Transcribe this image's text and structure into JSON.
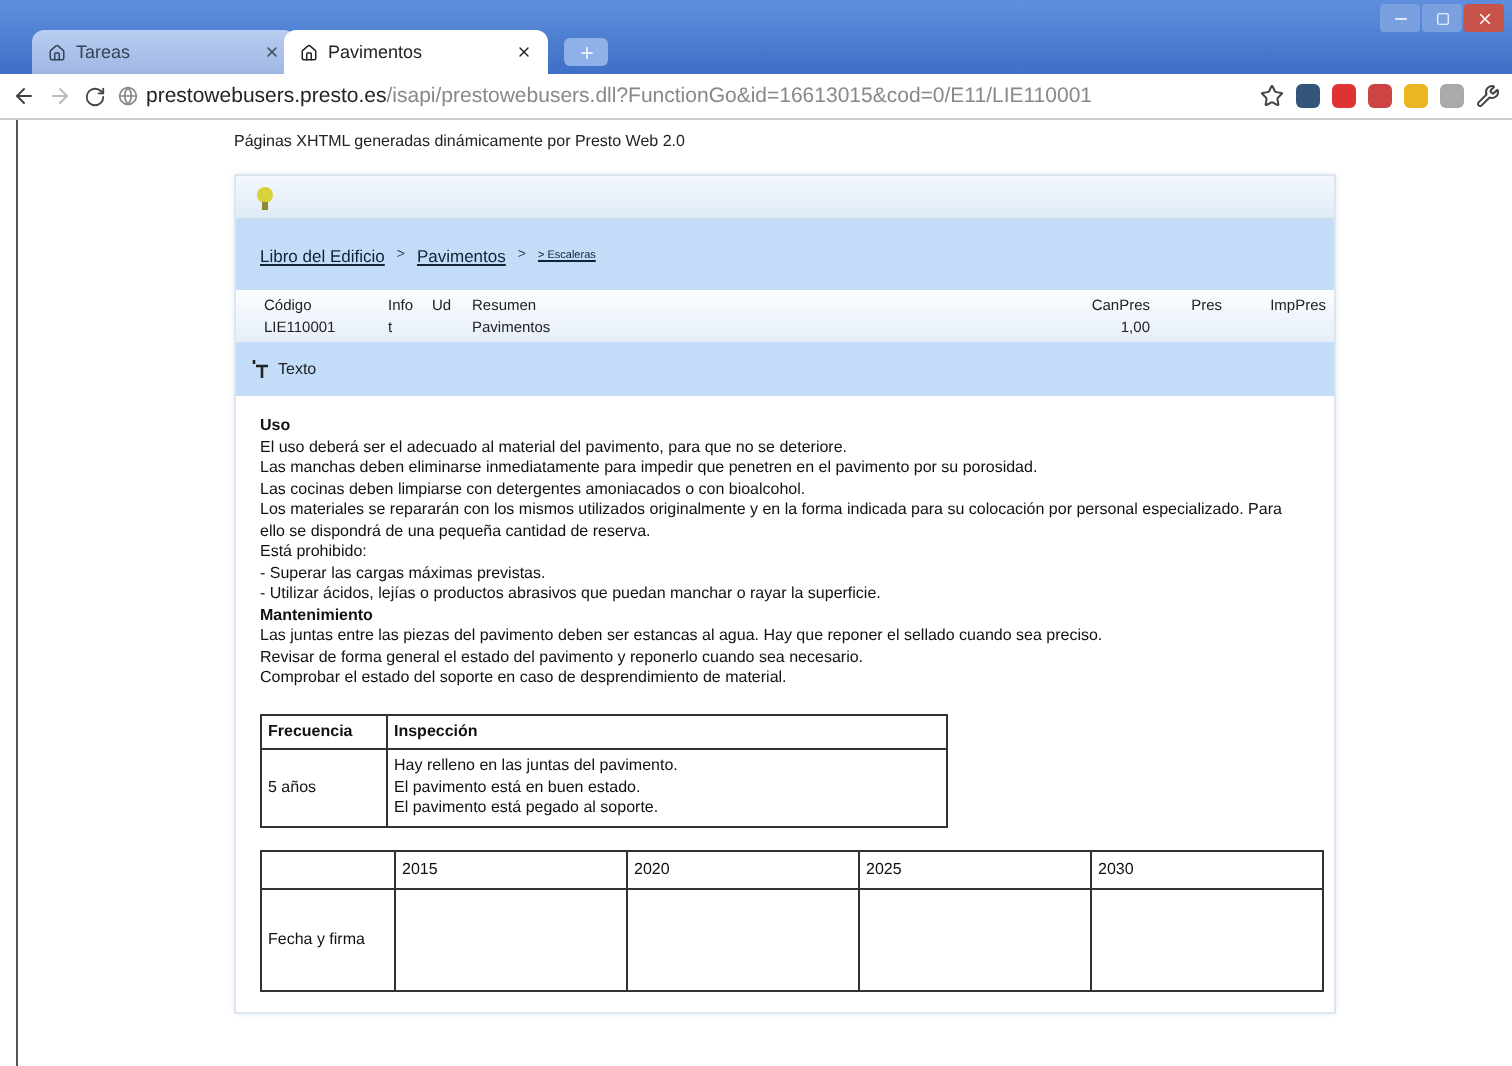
{
  "browser": {
    "tabs": [
      {
        "title": "Tareas",
        "selected": false
      },
      {
        "title": "Pavimentos",
        "selected": true
      }
    ],
    "url": {
      "host": "prestowebusers.presto.es",
      "path": "/isapi/prestowebusers.dll?FunctionGo&id=16613015&cod=0/E11/LIE110001"
    }
  },
  "page_header": "Páginas XHTML generadas dinámicamente por Presto Web 2.0",
  "breadcrumb": [
    {
      "label": "Libro del Edificio",
      "small": false
    },
    {
      "separator": ">",
      "label": "Pavimentos",
      "small": false
    },
    {
      "separator": ">",
      "label": "> Escaleras",
      "small": true
    }
  ],
  "table": {
    "columns": [
      "Código",
      "Info",
      "Ud",
      "Resumen",
      "CanPres",
      "Pres",
      "ImpPres"
    ],
    "rows": [
      [
        "LIE110001",
        "t",
        "",
        "Pavimentos",
        "1,00",
        "",
        ""
      ]
    ]
  },
  "section": {
    "label": "Texto"
  },
  "content": [
    {
      "kind": "heading",
      "text": "Uso"
    },
    {
      "kind": "line",
      "text": "El uso deberá ser el adecuado al material del pavimento, para que no se deteriore."
    },
    {
      "kind": "line",
      "text": "Las manchas deben eliminarse inmediatamente para impedir que penetren en el pavimento por su porosidad."
    },
    {
      "kind": "line",
      "text": "Las cocinas deben limpiarse con detergentes amoniacados o con bioalcohol."
    },
    {
      "kind": "line",
      "text": "Los materiales se repararán con los mismos utilizados originalmente y en la forma indicada para su colocación por personal especializado. Para ello se dispondrá de una pequeña cantidad de reserva."
    },
    {
      "kind": "line",
      "text": "Está prohibido:"
    },
    {
      "kind": "line",
      "text": "- Superar las cargas máximas previstas."
    },
    {
      "kind": "line",
      "text": "- Utilizar ácidos, lejías o productos abrasivos que puedan manchar o rayar la superficie."
    },
    {
      "kind": "heading",
      "text": "Mantenimiento"
    },
    {
      "kind": "line",
      "text": "Las juntas entre las piezas del pavimento deben ser estancas al agua. Hay que reponer el sellado cuando sea preciso."
    },
    {
      "kind": "line",
      "text": "Revisar de forma general el estado del pavimento y reponerlo cuando sea necesario."
    },
    {
      "kind": "line",
      "text": "Comprobar el estado del soporte en caso de desprendimiento de material."
    }
  ],
  "inspection": {
    "columns": [
      "Frecuencia",
      "Inspección"
    ],
    "rows": [
      {
        "frequency": "5 años",
        "items": [
          "Hay relleno en las juntas del pavimento.",
          "El pavimento está en buen estado.",
          "El pavimento está pegado al soporte."
        ]
      }
    ]
  },
  "schedule": {
    "years": [
      "2015",
      "2020",
      "2025",
      "2030"
    ],
    "row_label": "Fecha y firma"
  }
}
